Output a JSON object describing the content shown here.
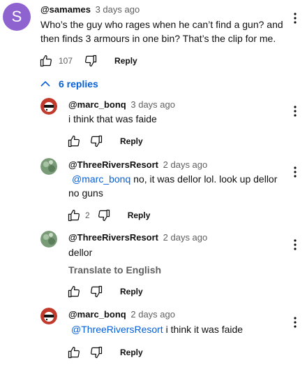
{
  "top_comment": {
    "avatar_letter": "S",
    "author": "@samames",
    "time": "3 days ago",
    "text_line1": "Who’s the guy who rages when he can’t find a gun? and",
    "text_line2": "then finds 3 armours in one bin? That’s the clip for me.",
    "likes": "107",
    "reply_label": "Reply"
  },
  "replies_toggle": {
    "label": "6 replies"
  },
  "replies": [
    {
      "author": "@marc_bonq",
      "time": "3 days ago",
      "text": "i think that was faide",
      "reply_label": "Reply"
    },
    {
      "author": "@ThreeRiversResort",
      "time": "2 days ago",
      "mention": "@marc_bonq",
      "text_line1": " no, it was dellor lol. look up dellor",
      "text_line2": "no guns",
      "likes": "2",
      "reply_label": "Reply"
    },
    {
      "author": "@ThreeRiversResort",
      "time": "2 days ago",
      "text": "dellor",
      "translate": "Translate to English",
      "reply_label": "Reply"
    },
    {
      "author": "@marc_bonq",
      "time": "2 days ago",
      "mention": "@ThreeRiversResort",
      "text": " i think it was faide",
      "reply_label": "Reply"
    }
  ],
  "colors": {
    "link": "#065fd4",
    "avatar_s": "#8e63d0",
    "muted": "#606060"
  }
}
